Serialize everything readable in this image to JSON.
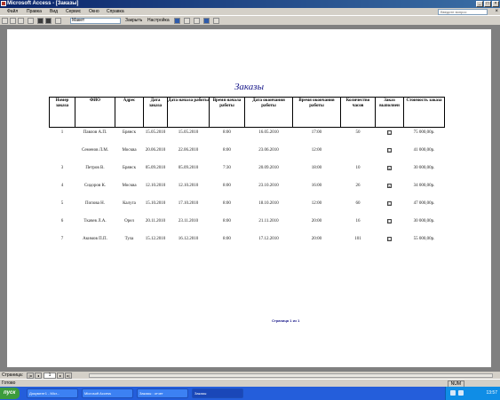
{
  "window": {
    "title": "Microsoft Access - [Заказы]"
  },
  "menu": {
    "items": [
      "Файл",
      "Правка",
      "Вид",
      "Сервис",
      "Окно",
      "Справка"
    ],
    "help_placeholder": "Введите вопрос"
  },
  "toolbar": {
    "zoom_value": "Макет",
    "close_label": "Закрыть",
    "setup_label": "Настройка"
  },
  "report": {
    "title": "Заказы",
    "columns": [
      "Номер заказа",
      "ФИО",
      "Адрес",
      "Дата заказа",
      "Дата начала работы",
      "Время начала работы",
      "Дата окончания работы",
      "Время окончания работы",
      "Количество часов",
      "Заказ выполнен",
      "Стоимость заказа"
    ],
    "rows": [
      [
        "1",
        "Павлов А.П.",
        "Брянск",
        "15.05.2010",
        "15.05.2010",
        "8:00",
        "16.05.2010",
        "17:00",
        "50",
        "☐",
        "75 000,00р."
      ],
      [
        "",
        "Семенов Л.М.",
        "Москва",
        "20.06.2010",
        "22.06.2010",
        "8:00",
        "23.06.2010",
        "12:00",
        "",
        "☐",
        "41 000,00р."
      ],
      [
        "3",
        "Петров В.",
        "Брянск",
        "05.09.2010",
        "05.09.2010",
        "7:30",
        "20.09.2010",
        "18:00",
        "10",
        "☑",
        "30 000,00р."
      ],
      [
        "4",
        "Сидоров К.",
        "Москва",
        "12.10.2010",
        "12.10.2010",
        "8:00",
        "23.10.2010",
        "16:00",
        "26",
        "☑",
        "34 000,00р."
      ],
      [
        "5",
        "Попова Н.",
        "Калуга",
        "15.10.2010",
        "17.10.2010",
        "8:00",
        "18.10.2010",
        "12:00",
        "60",
        "☐",
        "47 000,00р."
      ],
      [
        "6",
        "Ткачев Л.А.",
        "Орел",
        "20.11.2010",
        "23.11.2010",
        "8:00",
        "21.11.2010",
        "20:00",
        "16",
        "☐",
        "30 000,00р."
      ],
      [
        "7",
        "Акимов П.П.",
        "Тула",
        "15.12.2010",
        "16.12.2010",
        "8:00",
        "17.12.2010",
        "20:00",
        "101",
        "☐",
        "55 000,00р."
      ]
    ],
    "footer": "Страница 1 из 1"
  },
  "navigation": {
    "label": "Страница:",
    "page": "1"
  },
  "status": {
    "text": "Готово",
    "num": "NUM"
  },
  "taskbar": {
    "start": "пуск",
    "tasks": [
      "Документ1 - Micr...",
      "Microsoft Access",
      "Заказы : отчет",
      "Заказы"
    ],
    "clock": "13:57"
  }
}
